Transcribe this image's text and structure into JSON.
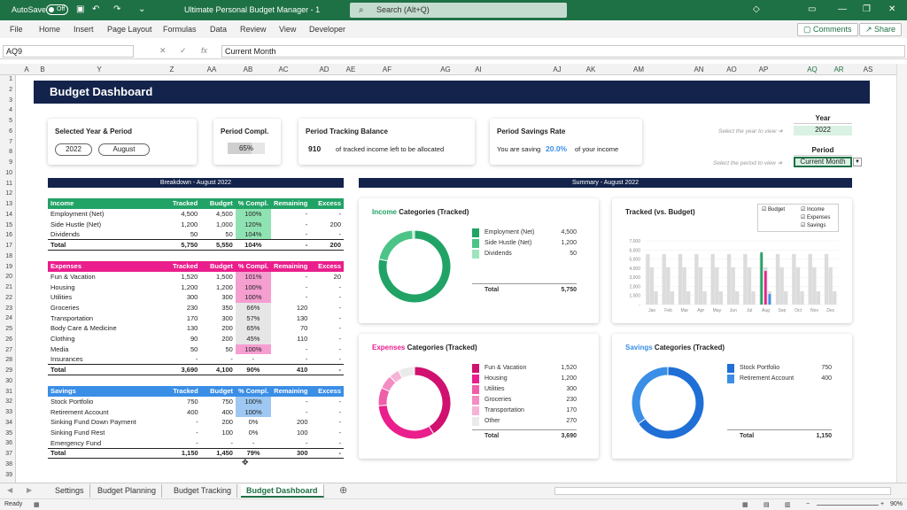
{
  "titlebar": {
    "autosave": "AutoSave",
    "autosave_state": "Off",
    "document": "Ultimate Personal Budget Manager  -  1",
    "search_placeholder": "Search (Alt+Q)"
  },
  "menu": [
    "File",
    "Home",
    "Insert",
    "Page Layout",
    "Formulas",
    "Data",
    "Review",
    "View",
    "Developer"
  ],
  "menu_buttons": {
    "comments": "Comments",
    "share": "Share"
  },
  "formula": {
    "name_box": "AQ9",
    "value": "Current Month"
  },
  "columns": [
    [
      "A",
      30
    ],
    [
      "B",
      48
    ],
    [
      "Y",
      112
    ],
    [
      "Z",
      194
    ],
    [
      "AA",
      239
    ],
    [
      "AB",
      280
    ],
    [
      "AC",
      320
    ],
    [
      "AD",
      366
    ],
    [
      "AE",
      396
    ],
    [
      "AF",
      437
    ],
    [
      "AG",
      503
    ],
    [
      "AI",
      540
    ],
    [
      "AJ",
      629
    ],
    [
      "AK",
      667
    ],
    [
      "AM",
      721
    ],
    [
      "AN",
      789
    ],
    [
      "AO",
      826
    ],
    [
      "AP",
      862
    ],
    [
      "AQ",
      917
    ],
    [
      "AR",
      947
    ],
    [
      "AS",
      980
    ]
  ],
  "rows": [
    "1",
    "2",
    "3",
    "4",
    "5",
    "6",
    "7",
    "8",
    "9",
    "10",
    "11",
    "12",
    "13",
    "14",
    "15",
    "16",
    "17",
    "18",
    "19",
    "20",
    "21",
    "22",
    "23",
    "24",
    "25",
    "26",
    "27",
    "28",
    "29",
    "30",
    "31",
    "32",
    "33",
    "34",
    "35",
    "36",
    "37",
    "38",
    "39"
  ],
  "dashboard": {
    "title": "Budget Dashboard",
    "selected_label": "Selected Year & Period",
    "year": "2022",
    "period": "August",
    "compl_label": "Period Compl.",
    "compl_value": "65%",
    "compl_fraction": 0.65,
    "balance_label": "Period Tracking Balance",
    "balance_value": "910",
    "balance_text": "of tracked income left to be allocated",
    "savings_label": "Period Savings Rate",
    "savings_pre": "You are saving",
    "savings_value": "20.0%",
    "savings_post": "of your income",
    "year_hint": "Select the year to view  ➔",
    "year_label": "Year",
    "year_value": "2022",
    "period_hint": "Select the period to view  ➔",
    "period_label": "Period",
    "period_value": "Current Month"
  },
  "breakdown_title": "Breakdown - August 2022",
  "summary_title": "Summary - August 2022",
  "headers": [
    "Tracked",
    "Budget",
    "% Compl.",
    "Remaining",
    "Excess"
  ],
  "income": {
    "title": "Income",
    "color": "#21a366",
    "hl": "#8fe3b3",
    "rows": [
      [
        "Employment (Net)",
        "4,500",
        "4,500",
        "100%",
        "-",
        "-",
        1
      ],
      [
        "Side Hustle (Net)",
        "1,200",
        "1,000",
        "120%",
        "-",
        "200",
        1
      ],
      [
        "Dividends",
        "50",
        "50",
        "104%",
        "-",
        "-",
        1
      ]
    ],
    "total": [
      "Total",
      "5,750",
      "5,550",
      "104%",
      "-",
      "200"
    ]
  },
  "expenses": {
    "title": "Expenses",
    "color": "#ea1e8c",
    "hl": "#f59ed0",
    "rows": [
      [
        "Fun & Vacation",
        "1,520",
        "1,500",
        "101%",
        "-",
        "20",
        1
      ],
      [
        "Housing",
        "1,200",
        "1,200",
        "100%",
        "-",
        "-",
        1
      ],
      [
        "Utilities",
        "300",
        "300",
        "100%",
        "-",
        "-",
        1
      ],
      [
        "Groceries",
        "230",
        "350",
        "66%",
        "120",
        "-",
        2
      ],
      [
        "Transportation",
        "170",
        "300",
        "57%",
        "130",
        "-",
        2
      ],
      [
        "Body Care & Medicine",
        "130",
        "200",
        "65%",
        "70",
        "-",
        2
      ],
      [
        "Clothing",
        "90",
        "200",
        "45%",
        "110",
        "-",
        2
      ],
      [
        "Media",
        "50",
        "50",
        "100%",
        "-",
        "-",
        1
      ],
      [
        "Insurances",
        "-",
        "-",
        "-",
        "-",
        "-",
        0
      ]
    ],
    "total": [
      "Total",
      "3,690",
      "4,100",
      "90%",
      "410",
      "-"
    ]
  },
  "savings": {
    "title": "Savings",
    "color": "#3a8ee6",
    "hl": "#9ec8f2",
    "rows": [
      [
        "Stock Portfolio",
        "750",
        "750",
        "100%",
        "-",
        "-",
        1
      ],
      [
        "Retirement Account",
        "400",
        "400",
        "100%",
        "-",
        "-",
        1
      ],
      [
        "Sinking Fund Down Payment",
        "-",
        "200",
        "0%",
        "200",
        "-",
        0
      ],
      [
        "Sinking Fund Rest",
        "-",
        "100",
        "0%",
        "100",
        "-",
        0
      ],
      [
        "Emergency Fund",
        "-",
        "-",
        "-",
        "-",
        "-",
        0
      ]
    ],
    "total": [
      "Total",
      "1,150",
      "1,450",
      "79%",
      "300",
      "-"
    ]
  },
  "chart_data": [
    {
      "type": "pie",
      "title_colored": "Income",
      "title_rest": " Categories (Tracked)",
      "categories": [
        "Employment (Net)",
        "Side Hustle (Net)",
        "Dividends"
      ],
      "values": [
        4500,
        1200,
        50
      ],
      "labels": [
        "4,500",
        "1,200",
        "50"
      ],
      "colors": [
        "#21a366",
        "#4cc487",
        "#9ee5bd"
      ],
      "total_label": "Total",
      "total": "5,750"
    },
    {
      "type": "pie",
      "title_colored": "Expenses",
      "title_rest": " Categories (Tracked)",
      "categories": [
        "Fun & Vacation",
        "Housing",
        "Utilities",
        "Groceries",
        "Transportation",
        "Other"
      ],
      "values": [
        1520,
        1200,
        300,
        230,
        170,
        270
      ],
      "labels": [
        "1,520",
        "1,200",
        "300",
        "230",
        "170",
        "270"
      ],
      "colors": [
        "#d0116f",
        "#ea1e8c",
        "#f05ea8",
        "#f48cc1",
        "#f7b3d7",
        "#eaeaea"
      ],
      "total_label": "Total",
      "total": "3,690"
    },
    {
      "type": "pie",
      "title_colored": "Savings",
      "title_rest": " Categories (Tracked)",
      "categories": [
        "Stock Portfolio",
        "Retirement Account"
      ],
      "values": [
        750,
        400
      ],
      "labels": [
        "750",
        "400"
      ],
      "colors": [
        "#1f6fd6",
        "#3a8ee6"
      ],
      "total_label": "Total",
      "total": "1,150"
    },
    {
      "type": "bar",
      "title": "Tracked (vs. Budget)",
      "legend": [
        "Budget",
        "Income",
        "Expenses",
        "Savings"
      ],
      "categories": [
        "Jan",
        "Feb",
        "Mar",
        "Apr",
        "May",
        "Jun",
        "Jul",
        "Aug",
        "Sep",
        "Oct",
        "Nov",
        "Dec"
      ],
      "yticks": [
        "7,000",
        "6,000",
        "5,000",
        "4,000",
        "3,000",
        "2,000",
        "1,000",
        "-"
      ],
      "ylim": [
        0,
        7000
      ],
      "budget": [
        [
          5550,
          4100,
          1450
        ],
        [
          5550,
          4100,
          1450
        ],
        [
          5550,
          4100,
          1450
        ],
        [
          5550,
          4100,
          1450
        ],
        [
          5550,
          4100,
          1450
        ],
        [
          5550,
          4100,
          1450
        ],
        [
          5550,
          4100,
          1450
        ],
        [
          5550,
          4100,
          1450
        ],
        [
          5550,
          4100,
          1450
        ],
        [
          5550,
          4100,
          1450
        ],
        [
          5550,
          4100,
          1450
        ],
        [
          5550,
          4100,
          1450
        ]
      ],
      "tracked": [
        [
          null,
          null,
          null
        ],
        [
          null,
          null,
          null
        ],
        [
          null,
          null,
          null
        ],
        [
          null,
          null,
          null
        ],
        [
          null,
          null,
          null
        ],
        [
          null,
          null,
          null
        ],
        [
          null,
          null,
          null
        ],
        [
          5750,
          3690,
          1150
        ],
        [
          null,
          null,
          null
        ],
        [
          null,
          null,
          null
        ],
        [
          null,
          null,
          null
        ],
        [
          null,
          null,
          null
        ]
      ],
      "colors": {
        "budget": "#dcdcdc",
        "income": "#21a366",
        "expenses": "#ea1e8c",
        "savings": "#3a8ee6"
      }
    }
  ],
  "tabs": [
    "Settings",
    "Budget Planning",
    "Budget Tracking",
    "Budget Dashboard"
  ],
  "active_tab": "Budget Dashboard",
  "status": {
    "ready": "Ready",
    "zoom": "90%"
  }
}
